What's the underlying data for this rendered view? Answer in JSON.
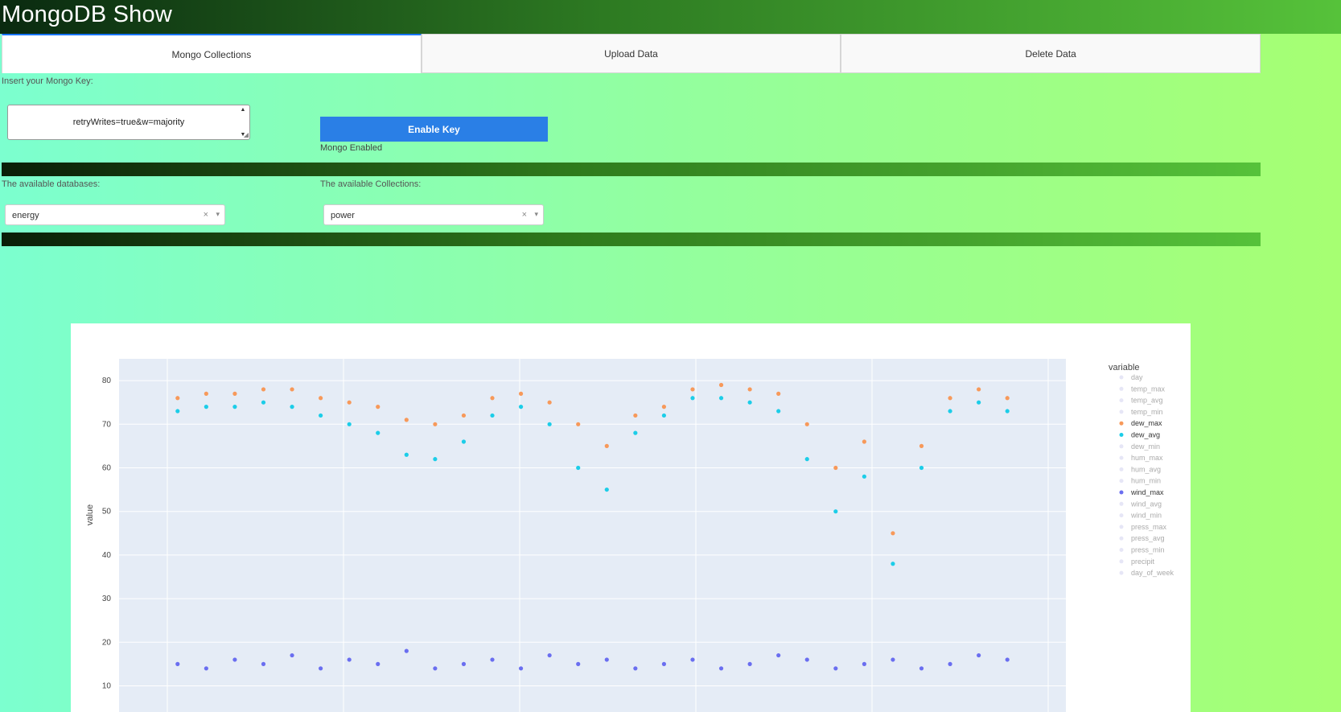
{
  "header": {
    "title": "MongoDB Show"
  },
  "tabs": [
    {
      "label": "Mongo Collections",
      "active": true
    },
    {
      "label": "Upload Data",
      "active": false
    },
    {
      "label": "Delete Data",
      "active": false
    }
  ],
  "key_section": {
    "label": "Insert your Mongo Key:",
    "value": "retryWrites=true&w=majority",
    "button_label": "Enable Key",
    "status": "Mongo Enabled"
  },
  "databases": {
    "label": "The available databases:",
    "selected": "energy"
  },
  "collections": {
    "label": "The available Collections:",
    "selected": "power"
  },
  "icons": {
    "clear": "×",
    "caret": "▾",
    "scroll_up": "▲",
    "scroll_down": "▼",
    "resize": "◢"
  },
  "colors": {
    "accent_button": "#2a7fe6",
    "orange_series": "#f7995a",
    "cyan_series": "#1ccde8",
    "purple_series": "#6a6ef0"
  },
  "chart_data": {
    "type": "scatter",
    "title": "",
    "xlabel": "",
    "ylabel": "value",
    "ylim": [
      4,
      85
    ],
    "yticks": [
      10,
      20,
      30,
      40,
      50,
      60,
      70,
      80
    ],
    "legend_title": "variable",
    "legend_position": "right",
    "legend": [
      {
        "name": "day",
        "active": false
      },
      {
        "name": "temp_max",
        "active": false
      },
      {
        "name": "temp_avg",
        "active": false
      },
      {
        "name": "temp_min",
        "active": false
      },
      {
        "name": "dew_max",
        "active": true
      },
      {
        "name": "dew_avg",
        "active": true
      },
      {
        "name": "dew_min",
        "active": false
      },
      {
        "name": "hum_max",
        "active": false
      },
      {
        "name": "hum_avg",
        "active": false
      },
      {
        "name": "hum_min",
        "active": false
      },
      {
        "name": "wind_max",
        "active": true
      },
      {
        "name": "wind_avg",
        "active": false
      },
      {
        "name": "wind_min",
        "active": false
      },
      {
        "name": "press_max",
        "active": false
      },
      {
        "name": "press_avg",
        "active": false
      },
      {
        "name": "press_min",
        "active": false
      },
      {
        "name": "precipit",
        "active": false
      },
      {
        "name": "day_of_week",
        "active": false
      }
    ],
    "series": [
      {
        "name": "dew_max",
        "color": "#f7995a",
        "x": [
          2,
          4,
          6,
          8,
          10,
          12,
          14,
          16,
          18,
          20,
          22,
          24,
          26,
          28,
          30,
          32,
          34,
          36,
          38,
          40,
          42,
          44,
          46,
          48,
          50,
          52,
          54,
          56,
          58,
          60
        ],
        "values": [
          76,
          77,
          77,
          78,
          78,
          76,
          75,
          74,
          71,
          70,
          72,
          76,
          77,
          75,
          70,
          65,
          72,
          74,
          78,
          79,
          78,
          77,
          70,
          60,
          66,
          45,
          65,
          76,
          78,
          76
        ]
      },
      {
        "name": "dew_avg",
        "color": "#1ccde8",
        "x": [
          2,
          4,
          6,
          8,
          10,
          12,
          14,
          16,
          18,
          20,
          22,
          24,
          26,
          28,
          30,
          32,
          34,
          36,
          38,
          40,
          42,
          44,
          46,
          48,
          50,
          52,
          54,
          56,
          58,
          60
        ],
        "values": [
          73,
          74,
          74,
          75,
          74,
          72,
          70,
          68,
          63,
          62,
          66,
          72,
          74,
          70,
          60,
          55,
          68,
          72,
          76,
          76,
          75,
          73,
          62,
          50,
          58,
          38,
          60,
          73,
          75,
          73
        ]
      },
      {
        "name": "wind_max",
        "color": "#6a6ef0",
        "x": [
          2,
          4,
          6,
          8,
          10,
          12,
          14,
          16,
          18,
          20,
          22,
          24,
          26,
          28,
          30,
          32,
          34,
          36,
          38,
          40,
          42,
          44,
          46,
          48,
          50,
          52,
          54,
          56,
          58,
          60
        ],
        "values": [
          15,
          14,
          16,
          15,
          17,
          14,
          16,
          15,
          18,
          14,
          15,
          16,
          14,
          17,
          15,
          16,
          14,
          15,
          16,
          14,
          15,
          17,
          16,
          14,
          15,
          16,
          14,
          15,
          17,
          16
        ]
      }
    ]
  }
}
